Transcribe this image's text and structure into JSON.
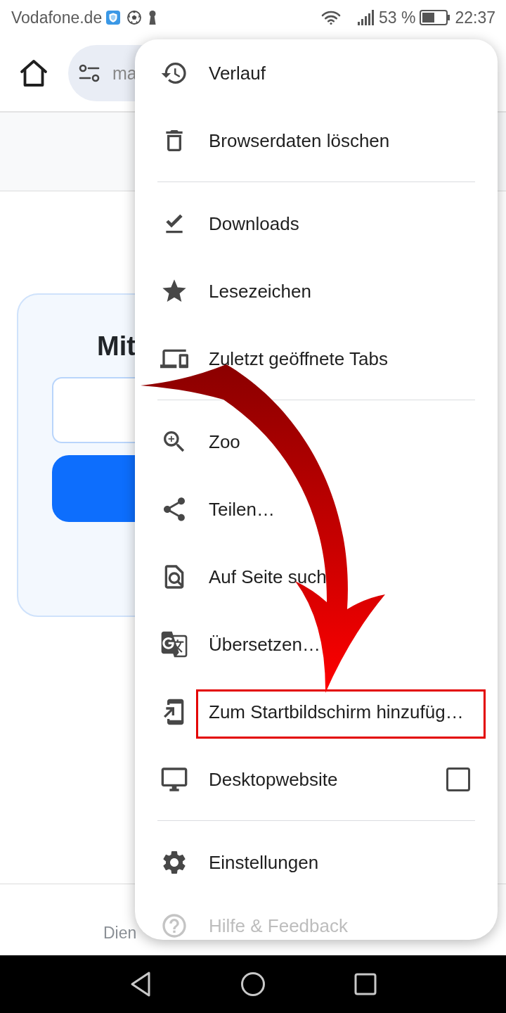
{
  "status_bar": {
    "carrier": "Vodafone.de",
    "battery": "53 %",
    "time": "22:37"
  },
  "toolbar": {
    "address": "ma"
  },
  "page": {
    "title": "Mit",
    "footer": "Dien"
  },
  "menu": {
    "sections": [
      {
        "items": [
          {
            "label": "Verlauf",
            "kind": "action",
            "highlighted": false
          },
          {
            "label": "Browserdaten löschen",
            "kind": "action",
            "highlighted": false
          }
        ]
      },
      {
        "items": [
          {
            "label": "Downloads",
            "kind": "action",
            "highlighted": false
          },
          {
            "label": "Lesezeichen",
            "kind": "action",
            "highlighted": false
          },
          {
            "label": "Zuletzt geöffnete Tabs",
            "kind": "action",
            "highlighted": false
          }
        ]
      },
      {
        "items": [
          {
            "label": "Zoo",
            "kind": "action",
            "highlighted": false
          },
          {
            "label": "Teilen…",
            "kind": "action",
            "highlighted": false
          },
          {
            "label": "Auf Seite such",
            "kind": "action",
            "highlighted": false
          },
          {
            "label": "Übersetzen…",
            "kind": "action",
            "highlighted": false
          },
          {
            "label": "Zum Startbildschirm hinzufüg…",
            "kind": "action",
            "highlighted": true
          },
          {
            "label": "Desktopwebsite",
            "kind": "checkbox",
            "checked": false,
            "highlighted": false
          }
        ]
      },
      {
        "items": [
          {
            "label": "Einstellungen",
            "kind": "action",
            "highlighted": false
          },
          {
            "label": "Hilfe & Feedback",
            "kind": "action",
            "highlighted": false
          }
        ]
      }
    ]
  }
}
